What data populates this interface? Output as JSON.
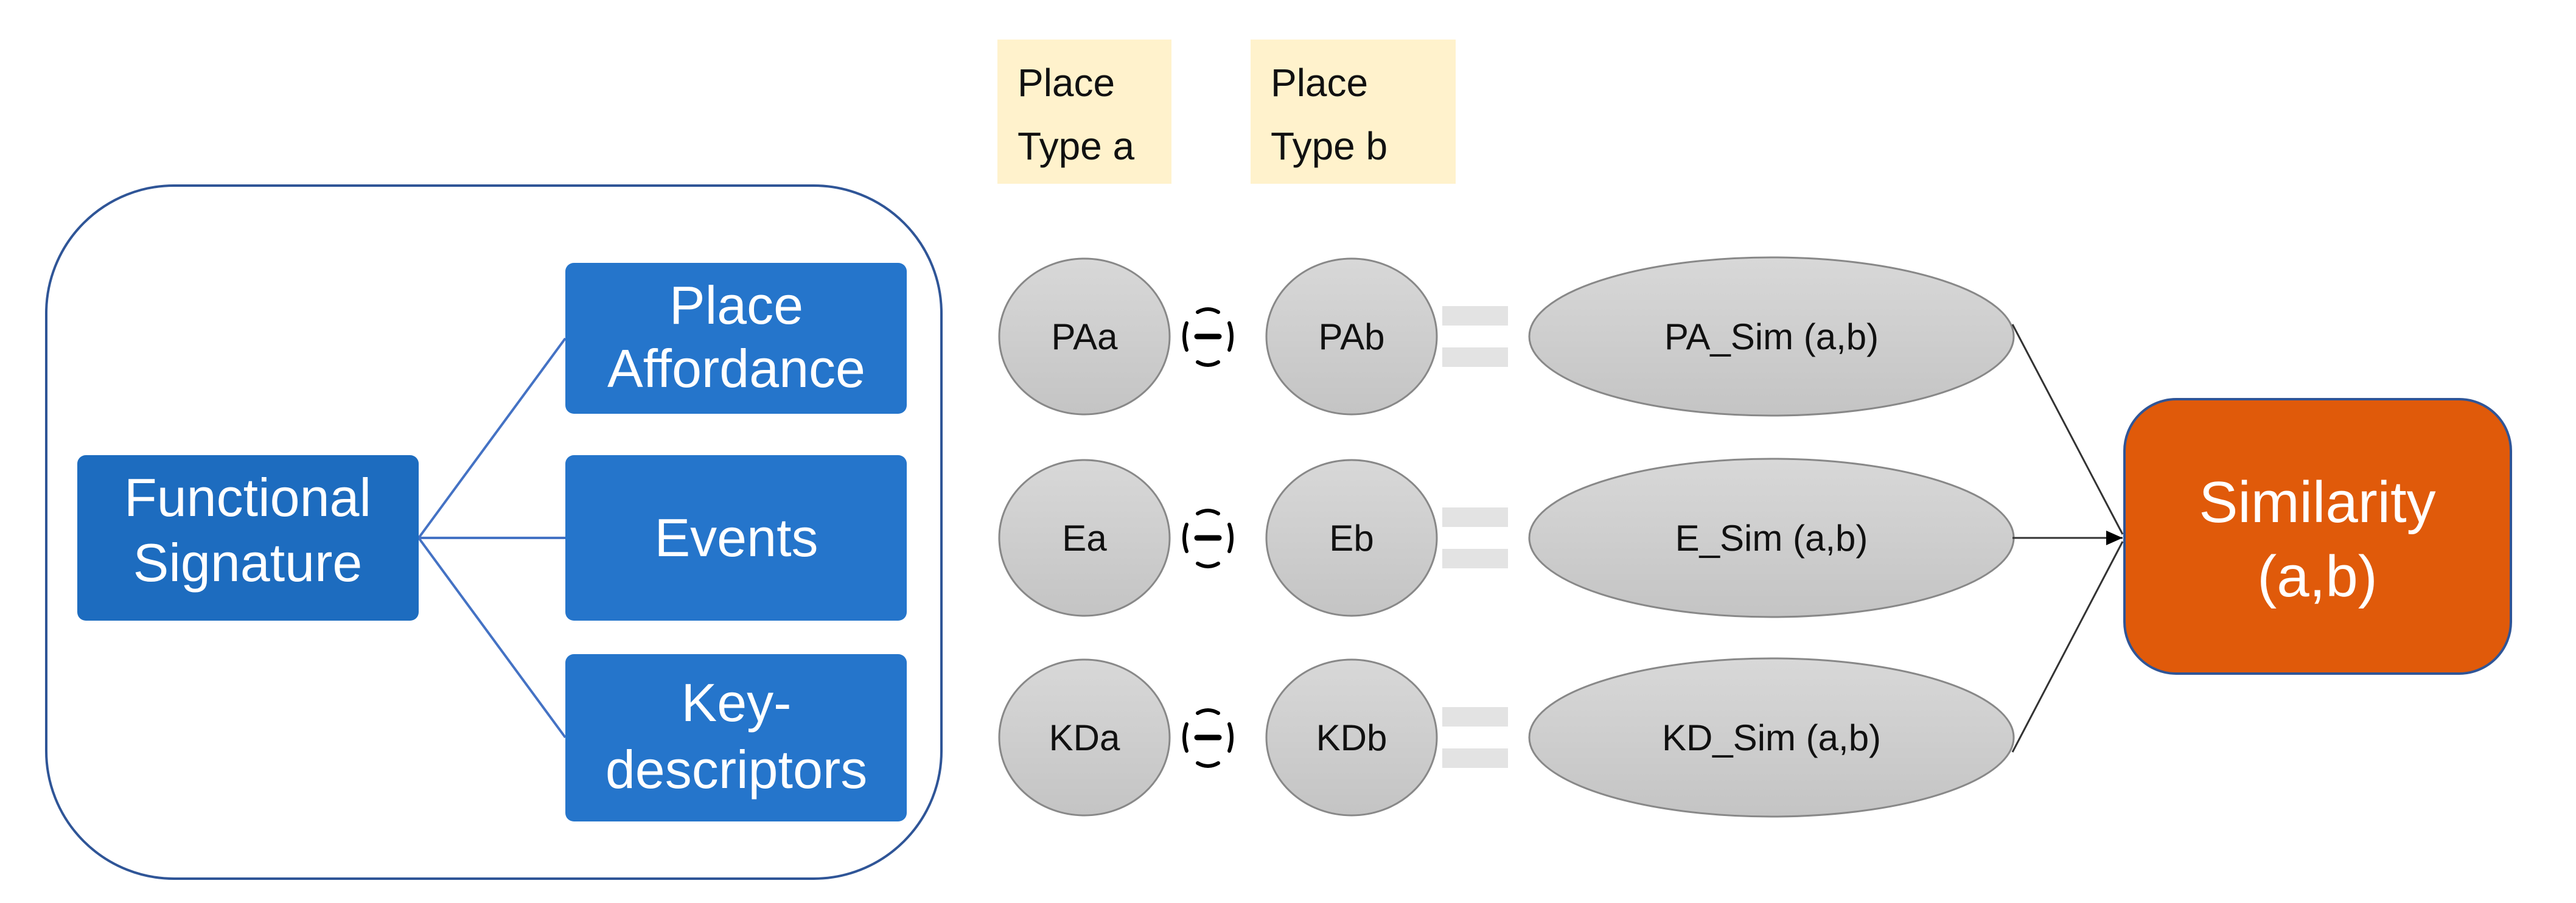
{
  "colors": {
    "signature_box": "#1D6CBF",
    "component_box": "#2575CB",
    "container_border": "#2F5597",
    "place_type_label_bg": "#FFF2CC",
    "node_fill": "#CFCFCF",
    "result_box": "#E05A0A",
    "equals_sign": "#E3E3E3"
  },
  "functional_signature": {
    "title_lines": [
      "Functional",
      "Signature"
    ],
    "components": [
      {
        "lines": [
          "Place",
          "Affordance"
        ]
      },
      {
        "lines": [
          "Events"
        ]
      },
      {
        "lines": [
          "Key-",
          "descriptors"
        ]
      }
    ]
  },
  "place_types": [
    {
      "lines": [
        "Place",
        "Type a"
      ]
    },
    {
      "lines": [
        "Place",
        "Type b"
      ]
    }
  ],
  "rows": [
    {
      "a": "PAa",
      "b": "PAb",
      "operator": "minus-in-circle",
      "result": "PA_Sim (a,b)"
    },
    {
      "a": "Ea",
      "b": "Eb",
      "operator": "minus-in-circle",
      "result": "E_Sim (a,b)"
    },
    {
      "a": "KDa",
      "b": "KDb",
      "operator": "minus-in-circle",
      "result": "KD_Sim (a,b)"
    }
  ],
  "similarity": {
    "lines": [
      "Similarity",
      "(a,b)"
    ]
  }
}
